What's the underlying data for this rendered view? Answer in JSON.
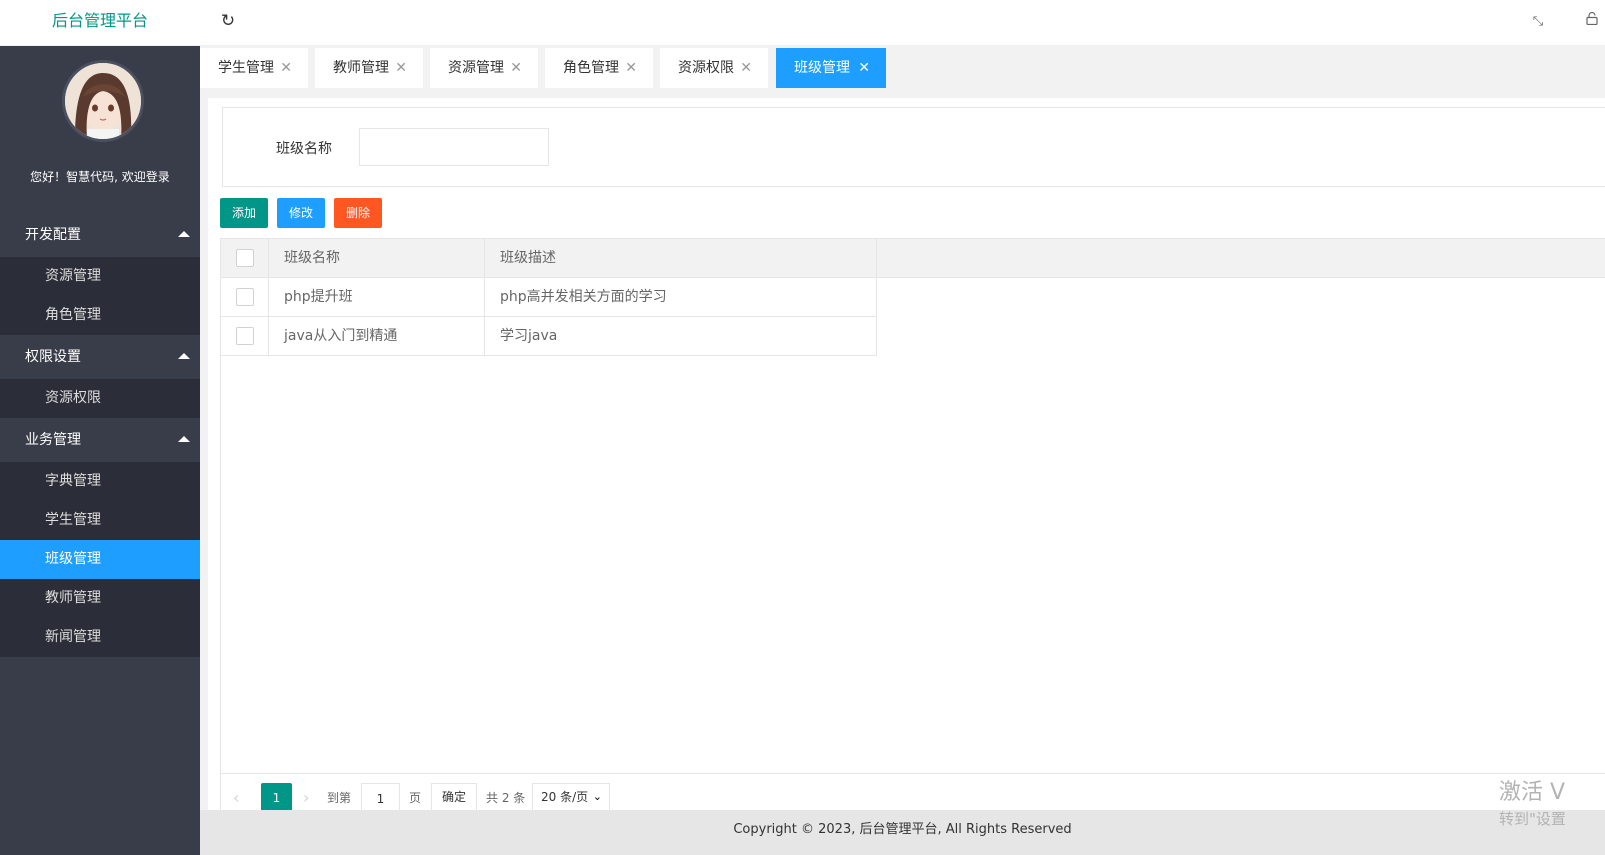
{
  "header": {
    "logo": "后台管理平台",
    "refresh_icon": "refresh-icon",
    "fullscreen_icon": "fullscreen-icon",
    "lock_icon": "lock-icon"
  },
  "sidebar": {
    "welcome": "您好！智慧代码, 欢迎登录",
    "groups": [
      {
        "label": "开发配置",
        "items": [
          "资源管理",
          "角色管理"
        ]
      },
      {
        "label": "权限设置",
        "items": [
          "资源权限"
        ]
      },
      {
        "label": "业务管理",
        "items": [
          "字典管理",
          "学生管理",
          "班级管理",
          "教师管理",
          "新闻管理"
        ]
      }
    ],
    "active_item": "班级管理"
  },
  "tabs": [
    {
      "label": "学生管理"
    },
    {
      "label": "教师管理"
    },
    {
      "label": "资源管理"
    },
    {
      "label": "角色管理"
    },
    {
      "label": "资源权限"
    },
    {
      "label": "班级管理"
    }
  ],
  "search": {
    "label": "班级名称",
    "value": ""
  },
  "toolbar": {
    "add": "添加",
    "edit": "修改",
    "delete": "删除"
  },
  "table": {
    "headers": [
      "班级名称",
      "班级描述"
    ],
    "rows": [
      [
        "php提升班",
        "php高并发相关方面的学习"
      ],
      [
        "java从入门到精通",
        "学习java"
      ]
    ]
  },
  "pager": {
    "prev": "‹",
    "current": "1",
    "next": "›",
    "goto": "到第",
    "page_input": "1",
    "page_unit": "页",
    "confirm": "确定",
    "total": "共 2 条",
    "page_size": "20 条/页"
  },
  "footer": {
    "copyright": "Copyright © 2023, 后台管理平台, All Rights Reserved"
  },
  "watermark": {
    "line1": "激活 V",
    "line2": "转到\"设置"
  }
}
